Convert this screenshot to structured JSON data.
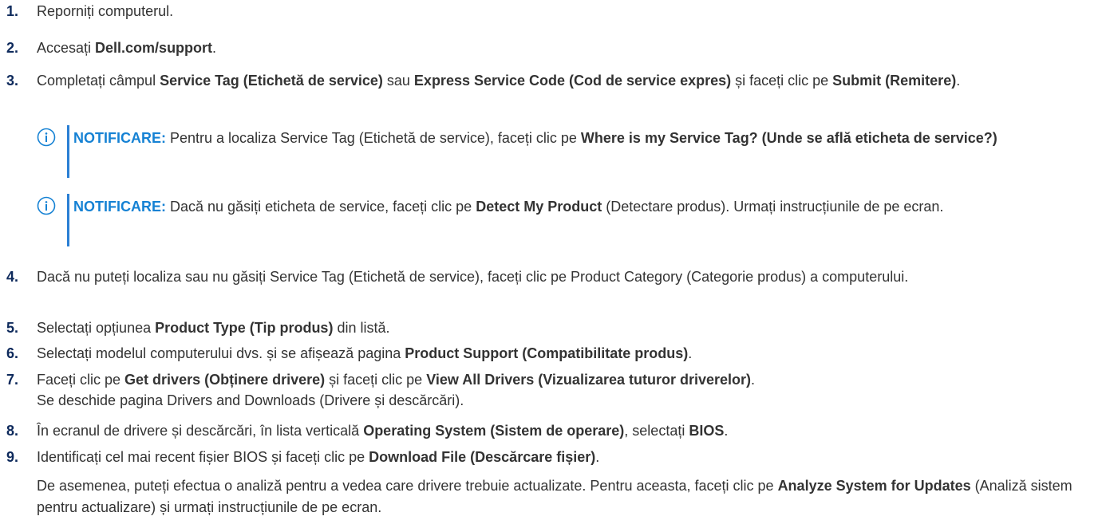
{
  "steps": [
    {
      "num": "1.",
      "parts": [
        {
          "t": "Reporniți computerul."
        }
      ]
    },
    {
      "num": "2.",
      "parts": [
        {
          "t": "Accesați "
        },
        {
          "t": "Dell.com/support",
          "b": true
        },
        {
          "t": "."
        }
      ]
    },
    {
      "num": "3.",
      "parts": [
        {
          "t": "Completați câmpul "
        },
        {
          "t": "Service Tag (Etichetă de service)",
          "b": true
        },
        {
          "t": " sau "
        },
        {
          "t": "Express Service Code (Cod de service expres)",
          "b": true
        },
        {
          "t": " și faceți clic pe "
        },
        {
          "t": "Submit (Remitere)",
          "b": true
        },
        {
          "t": "."
        }
      ]
    },
    {
      "num": "4.",
      "parts": [
        {
          "t": "Dacă nu puteți localiza sau nu găsiți Service Tag (Etichetă de service), faceți clic pe Product Category (Categorie produs) a computerului."
        }
      ]
    },
    {
      "num": "5.",
      "parts": [
        {
          "t": "Selectați opțiunea "
        },
        {
          "t": "Product Type (Tip produs)",
          "b": true
        },
        {
          "t": " din listă."
        }
      ]
    },
    {
      "num": "6.",
      "parts": [
        {
          "t": "Selectați modelul computerului dvs. și se afișează pagina "
        },
        {
          "t": "Product Support (Compatibilitate produs)",
          "b": true
        },
        {
          "t": "."
        }
      ]
    },
    {
      "num": "7.",
      "parts": [
        {
          "t": "Faceți clic pe "
        },
        {
          "t": "Get drivers (Obținere drivere)",
          "b": true
        },
        {
          "t": " și faceți clic pe "
        },
        {
          "t": "View All Drivers (Vizualizarea tuturor driverelor)",
          "b": true
        },
        {
          "t": "."
        },
        {
          "br": true
        },
        {
          "t": "Se deschide pagina Drivers and Downloads (Drivere și descărcări)."
        }
      ]
    },
    {
      "num": "8.",
      "parts": [
        {
          "t": "În ecranul de drivere și descărcări, în lista verticală "
        },
        {
          "t": "Operating System (Sistem de operare)",
          "b": true
        },
        {
          "t": ", selectați "
        },
        {
          "t": "BIOS",
          "b": true
        },
        {
          "t": "."
        }
      ]
    },
    {
      "num": "9.",
      "parts": [
        {
          "t": "Identificați cel mai recent fișier BIOS și faceți clic pe "
        },
        {
          "t": "Download File (Descărcare fișier)",
          "b": true
        },
        {
          "t": "."
        }
      ]
    }
  ],
  "notes": [
    {
      "label": "NOTIFICARE:",
      "parts": [
        {
          "t": " Pentru a localiza Service Tag (Etichetă de service), faceți clic pe "
        },
        {
          "t": "Where is my Service Tag? (Unde se află eticheta de service?)",
          "b": true
        }
      ]
    },
    {
      "label": "NOTIFICARE:",
      "parts": [
        {
          "t": " Dacă nu găsiți eticheta de service, faceți clic pe "
        },
        {
          "t": "Detect My Product",
          "b": true
        },
        {
          "t": " (Detectare produs). Urmați instrucțiunile de pe ecran."
        }
      ]
    }
  ],
  "final_paragraph": {
    "parts": [
      {
        "t": "De asemenea, puteți efectua o analiză pentru a vedea care drivere trebuie actualizate. Pentru aceasta, faceți clic pe "
      },
      {
        "t": "Analyze System for Updates",
        "b": true
      },
      {
        "t": " (Analiză sistem pentru actualizare) și urmați instrucțiunile de pe ecran."
      }
    ]
  },
  "colors": {
    "step_number": "#0e2a5c",
    "note_accent": "#1682d4",
    "text": "#333333"
  },
  "icons": {
    "note_icon": "info-circle-icon"
  }
}
